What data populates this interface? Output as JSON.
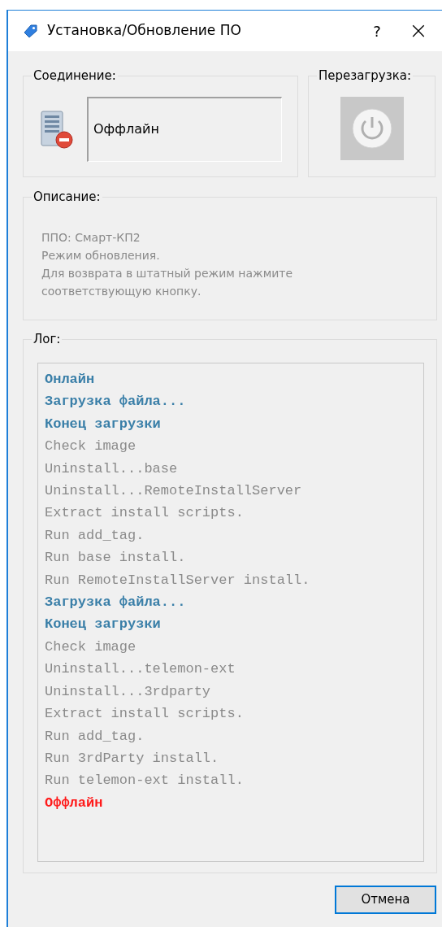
{
  "window": {
    "title": "Установка/Обновление ПО",
    "help": "?",
    "close": "×"
  },
  "connection": {
    "label": "Соединение:",
    "status": "Оффлайн"
  },
  "reboot": {
    "label": "Перезагрузка:",
    "disabled": true
  },
  "description": {
    "label": "Описание:",
    "lines": [
      "ППО: Смарт-КП2",
      "Режим обновления.",
      "Для возврата в штатный режим нажмите",
      "соответствующую кнопку."
    ]
  },
  "log": {
    "label": "Лог:",
    "lines": [
      {
        "kind": "info",
        "text": "Онлайн"
      },
      {
        "kind": "info",
        "text": "Загрузка файла..."
      },
      {
        "kind": "info",
        "text": "Конец загрузки"
      },
      {
        "kind": "plain",
        "text": "Check image"
      },
      {
        "kind": "plain",
        "text": "Uninstall...base"
      },
      {
        "kind": "plain",
        "text": "Uninstall...RemoteInstallServer"
      },
      {
        "kind": "plain",
        "text": "Extract install scripts."
      },
      {
        "kind": "plain",
        "text": "Run add_tag."
      },
      {
        "kind": "plain",
        "text": "Run base install."
      },
      {
        "kind": "plain",
        "text": "Run RemoteInstallServer install."
      },
      {
        "kind": "info",
        "text": "Загрузка файла..."
      },
      {
        "kind": "info",
        "text": "Конец загрузки"
      },
      {
        "kind": "plain",
        "text": "Check image"
      },
      {
        "kind": "plain",
        "text": "Uninstall...telemon-ext"
      },
      {
        "kind": "plain",
        "text": "Uninstall...3rdparty"
      },
      {
        "kind": "plain",
        "text": "Extract install scripts."
      },
      {
        "kind": "plain",
        "text": "Run add_tag."
      },
      {
        "kind": "plain",
        "text": "Run 3rdParty install."
      },
      {
        "kind": "plain",
        "text": "Run telemon-ext install."
      },
      {
        "kind": "error",
        "text": "Оффлайн"
      }
    ]
  },
  "buttons": {
    "cancel": "Отмена"
  }
}
